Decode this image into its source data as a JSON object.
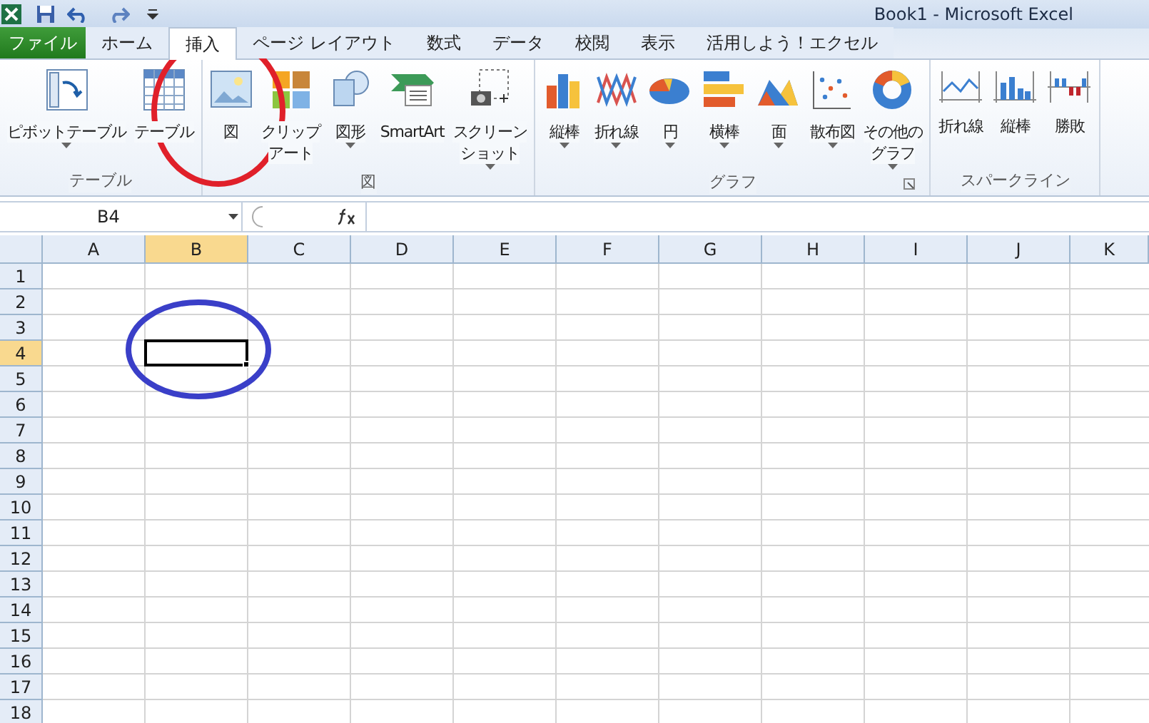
{
  "window": {
    "title": "Book1  -  Microsoft Excel"
  },
  "tabs": [
    {
      "label": "ファイル",
      "kind": "file",
      "selected": false
    },
    {
      "label": "ホーム",
      "kind": "tab",
      "selected": false
    },
    {
      "label": "挿入",
      "kind": "tab",
      "selected": true
    },
    {
      "label": "ページ レイアウト",
      "kind": "tab",
      "selected": false
    },
    {
      "label": "数式",
      "kind": "tab",
      "selected": false
    },
    {
      "label": "データ",
      "kind": "tab",
      "selected": false
    },
    {
      "label": "校閲",
      "kind": "tab",
      "selected": false
    },
    {
      "label": "表示",
      "kind": "tab",
      "selected": false
    },
    {
      "label": "活用しよう！エクセル",
      "kind": "tab",
      "selected": false
    }
  ],
  "ribbon": {
    "groups": [
      {
        "label": "テーブル",
        "launcher": false,
        "buttons": [
          {
            "label": "ピボットテーブル",
            "dropdown": true
          },
          {
            "label": "テーブル",
            "dropdown": false
          }
        ]
      },
      {
        "label": "図",
        "launcher": false,
        "buttons": [
          {
            "label": "図",
            "dropdown": false
          },
          {
            "label": [
              "クリップ",
              "アート"
            ],
            "dropdown": false
          },
          {
            "label": "図形",
            "dropdown": true
          },
          {
            "label": "SmartArt",
            "dropdown": false
          },
          {
            "label": [
              "スクリーン",
              "ショット"
            ],
            "dropdown": true
          }
        ]
      },
      {
        "label": "グラフ",
        "launcher": true,
        "buttons": [
          {
            "label": "縦棒",
            "dropdown": true
          },
          {
            "label": "折れ線",
            "dropdown": true
          },
          {
            "label": "円",
            "dropdown": true
          },
          {
            "label": "横棒",
            "dropdown": true
          },
          {
            "label": "面",
            "dropdown": true
          },
          {
            "label": "散布図",
            "dropdown": true
          },
          {
            "label": [
              "その他の",
              "グラフ"
            ],
            "dropdown": true
          }
        ]
      },
      {
        "label": "スパークライン",
        "launcher": false,
        "buttons": [
          {
            "label": "折れ線",
            "dropdown": false
          },
          {
            "label": "縦棒",
            "dropdown": false
          },
          {
            "label": "勝敗",
            "dropdown": false
          }
        ]
      }
    ]
  },
  "formula_bar": {
    "name_box": "B4"
  },
  "sheet": {
    "columns": [
      {
        "label": "A",
        "selected": false
      },
      {
        "label": "B",
        "selected": true
      },
      {
        "label": "C",
        "selected": false
      },
      {
        "label": "D",
        "selected": false
      },
      {
        "label": "E",
        "selected": false
      },
      {
        "label": "F",
        "selected": false
      },
      {
        "label": "G",
        "selected": false
      },
      {
        "label": "H",
        "selected": false
      },
      {
        "label": "I",
        "selected": false
      },
      {
        "label": "J",
        "selected": false
      },
      {
        "label": "K",
        "selected": false
      }
    ],
    "rows": [
      {
        "label": "1",
        "selected": false
      },
      {
        "label": "2",
        "selected": false
      },
      {
        "label": "3",
        "selected": false
      },
      {
        "label": "4",
        "selected": true
      },
      {
        "label": "5",
        "selected": false
      },
      {
        "label": "6",
        "selected": false
      },
      {
        "label": "7",
        "selected": false
      },
      {
        "label": "8",
        "selected": false
      },
      {
        "label": "9",
        "selected": false
      },
      {
        "label": "10",
        "selected": false
      },
      {
        "label": "11",
        "selected": false
      },
      {
        "label": "12",
        "selected": false
      },
      {
        "label": "13",
        "selected": false
      },
      {
        "label": "14",
        "selected": false
      },
      {
        "label": "15",
        "selected": false
      },
      {
        "label": "16",
        "selected": false
      },
      {
        "label": "17",
        "selected": false
      },
      {
        "label": "18",
        "selected": false
      }
    ]
  }
}
